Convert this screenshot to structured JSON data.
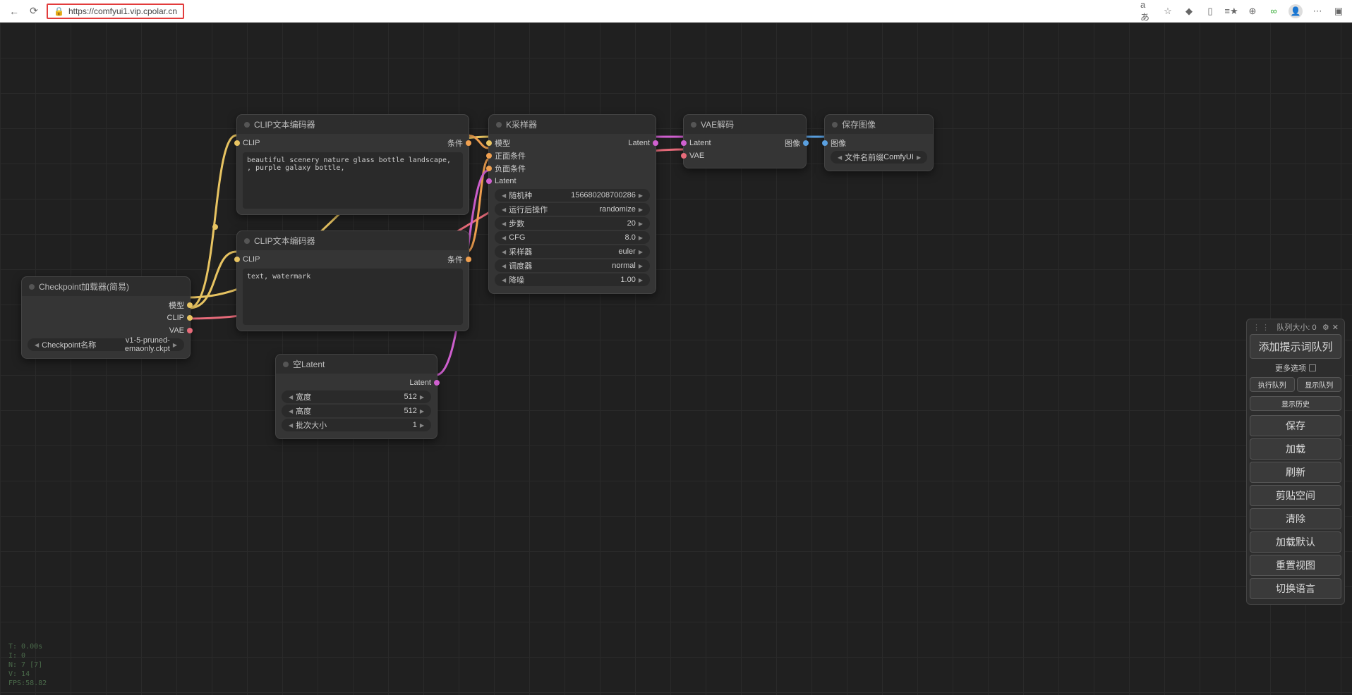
{
  "browser": {
    "url": "https://comfyui1.vip.cpolar.cn",
    "aa_label": "aあ"
  },
  "nodes": {
    "checkpoint": {
      "title": "Checkpoint加载器(简易)",
      "out_model": "模型",
      "out_clip": "CLIP",
      "out_vae": "VAE",
      "widget_label": "Checkpoint名称",
      "widget_value": "v1-5-pruned-emaonly.ckpt"
    },
    "clip1": {
      "title": "CLIP文本编码器",
      "in_clip": "CLIP",
      "out_cond": "条件",
      "text": "beautiful scenery nature glass bottle landscape, , purple galaxy bottle,"
    },
    "clip2": {
      "title": "CLIP文本编码器",
      "in_clip": "CLIP",
      "out_cond": "条件",
      "text": "text, watermark"
    },
    "latent": {
      "title": "空Latent",
      "out_latent": "Latent",
      "w_width_label": "宽度",
      "w_width_val": "512",
      "w_height_label": "高度",
      "w_height_val": "512",
      "w_batch_label": "批次大小",
      "w_batch_val": "1"
    },
    "ksampler": {
      "title": "K采样器",
      "in_model": "模型",
      "in_pos": "正面条件",
      "in_neg": "负面条件",
      "in_latent": "Latent",
      "out_latent": "Latent",
      "w_seed_l": "随机种",
      "w_seed_v": "156680208700286",
      "w_after_l": "运行后操作",
      "w_after_v": "randomize",
      "w_steps_l": "步数",
      "w_steps_v": "20",
      "w_cfg_l": "CFG",
      "w_cfg_v": "8.0",
      "w_sampler_l": "采样器",
      "w_sampler_v": "euler",
      "w_sched_l": "调度器",
      "w_sched_v": "normal",
      "w_denoise_l": "降噪",
      "w_denoise_v": "1.00"
    },
    "vae": {
      "title": "VAE解码",
      "in_latent": "Latent",
      "in_vae": "VAE",
      "out_image": "图像"
    },
    "save": {
      "title": "保存图像",
      "in_image": "图像",
      "w_prefix_l": "文件名前缀",
      "w_prefix_v": "ComfyUI"
    }
  },
  "panel": {
    "queue_label": "队列大小: 0",
    "add_prompt": "添加提示词队列",
    "more_opts": "更多选项",
    "exec_queue": "执行队列",
    "show_queue": "显示队列",
    "show_history": "显示历史",
    "save": "保存",
    "load": "加载",
    "refresh": "刷新",
    "clipspace": "剪贴空间",
    "clear": "清除",
    "load_default": "加载默认",
    "reset_view": "重置视图",
    "toggle_lang": "切换语言"
  },
  "stats": {
    "l1": "T: 0.00s",
    "l2": "I: 0",
    "l3": "N: 7 [7]",
    "l4": "V: 14",
    "l5": "FPS:58.82"
  }
}
